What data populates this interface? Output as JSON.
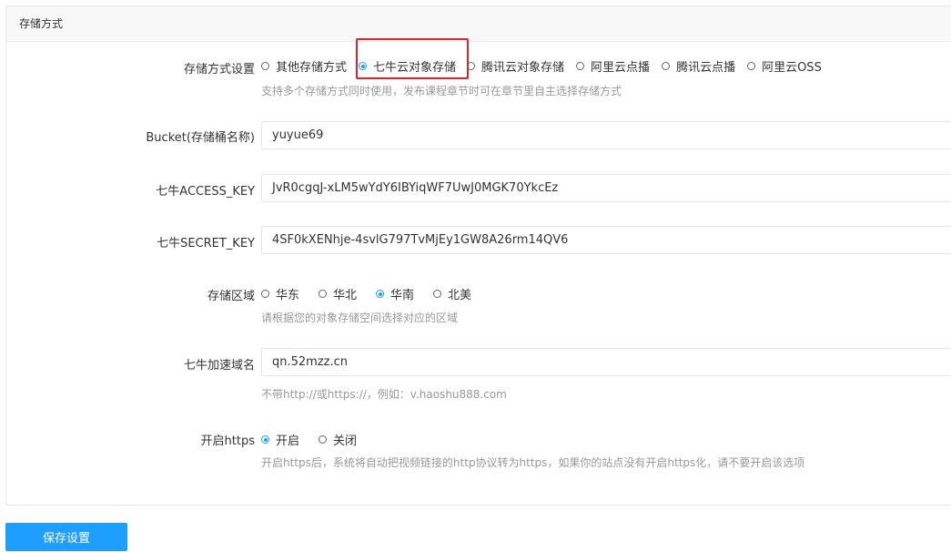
{
  "panel": {
    "title": "存储方式"
  },
  "storage_method": {
    "label": "存储方式设置",
    "options": [
      {
        "label": "其他存储方式",
        "checked": false
      },
      {
        "label": "七牛云对象存储",
        "checked": true
      },
      {
        "label": "腾讯云对象存储",
        "checked": false
      },
      {
        "label": "阿里云点播",
        "checked": false
      },
      {
        "label": "腾讯云点播",
        "checked": false
      },
      {
        "label": "阿里云OSS",
        "checked": false
      }
    ],
    "hint": "支持多个存储方式同时使用，发布课程章节时可在章节里自主选择存储方式"
  },
  "bucket": {
    "label": "Bucket(存储桶名称)",
    "value": "yuyue69"
  },
  "access_key": {
    "label": "七牛ACCESS_KEY",
    "value": "JvR0cgqJ-xLM5wYdY6IBYiqWF7UwJ0MGK70YkcEz"
  },
  "secret_key": {
    "label": "七牛SECRET_KEY",
    "value": "4SF0kXENhje-4svlG797TvMjEy1GW8A26rm14QV6"
  },
  "region": {
    "label": "存储区域",
    "options": [
      {
        "label": "华东",
        "checked": false
      },
      {
        "label": "华北",
        "checked": false
      },
      {
        "label": "华南",
        "checked": true
      },
      {
        "label": "北美",
        "checked": false
      }
    ],
    "hint": "请根据您的对象存储空间选择对应的区域"
  },
  "domain": {
    "label": "七牛加速域名",
    "value": "qn.52mzz.cn",
    "hint": "不带http://或https://，例如：v.haoshu888.com"
  },
  "https": {
    "label": "开启https",
    "options": [
      {
        "label": "开启",
        "checked": true
      },
      {
        "label": "关闭",
        "checked": false
      }
    ],
    "hint": "开启https后，系统将自动把视频链接的http协议转为https，如果你的站点没有开启https化，请不要开启该选项"
  },
  "actions": {
    "save_label": "保存设置"
  },
  "colors": {
    "accent": "#1e9fff",
    "highlight": "#e02424"
  }
}
